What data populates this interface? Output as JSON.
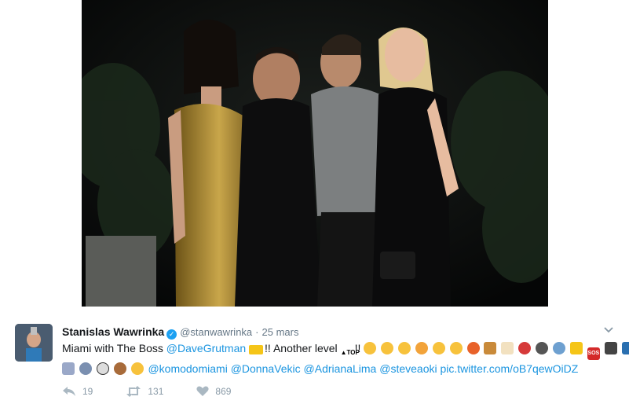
{
  "tweet": {
    "display_name": "Stanislas Wawrinka",
    "handle": "@stanwawrinka",
    "separator": "·",
    "date": "25 mars",
    "text_prefix": "Miami with The Boss",
    "mention_dave": "@DaveGrutman",
    "text_after_crown": "!! Another level",
    "text_after_top": "!!",
    "mentions": [
      "@komodomiami",
      "@DonnaVekic",
      "@AdrianaLima",
      "@steveaoki"
    ],
    "pic_link": "pic.twitter.com/oB7qewOiDZ",
    "emoji_line1": [
      "thinking",
      "kiss",
      "rolling-eyes",
      "heart-eyes-cat",
      "sunglasses",
      "joy",
      "collision",
      "whisky",
      "cake",
      "dancer",
      "man-dancing",
      "man-shrugging",
      "warning",
      "sos",
      "camera",
      "fireworks"
    ],
    "emoji_line2": [
      "musical-score",
      "headphones",
      "panda",
      "bear",
      "kiss-face"
    ]
  },
  "actions": {
    "reply_count": "19",
    "retweet_count": "131",
    "like_count": "869"
  },
  "icons": {
    "verified": "verified-badge-icon",
    "chevron": "chevron-down-icon",
    "reply": "reply-icon",
    "retweet": "retweet-icon",
    "like": "heart-icon"
  },
  "colors": {
    "link": "#1b95e0",
    "verified": "#1da1f2",
    "muted": "#657786",
    "action": "#8899a6"
  }
}
